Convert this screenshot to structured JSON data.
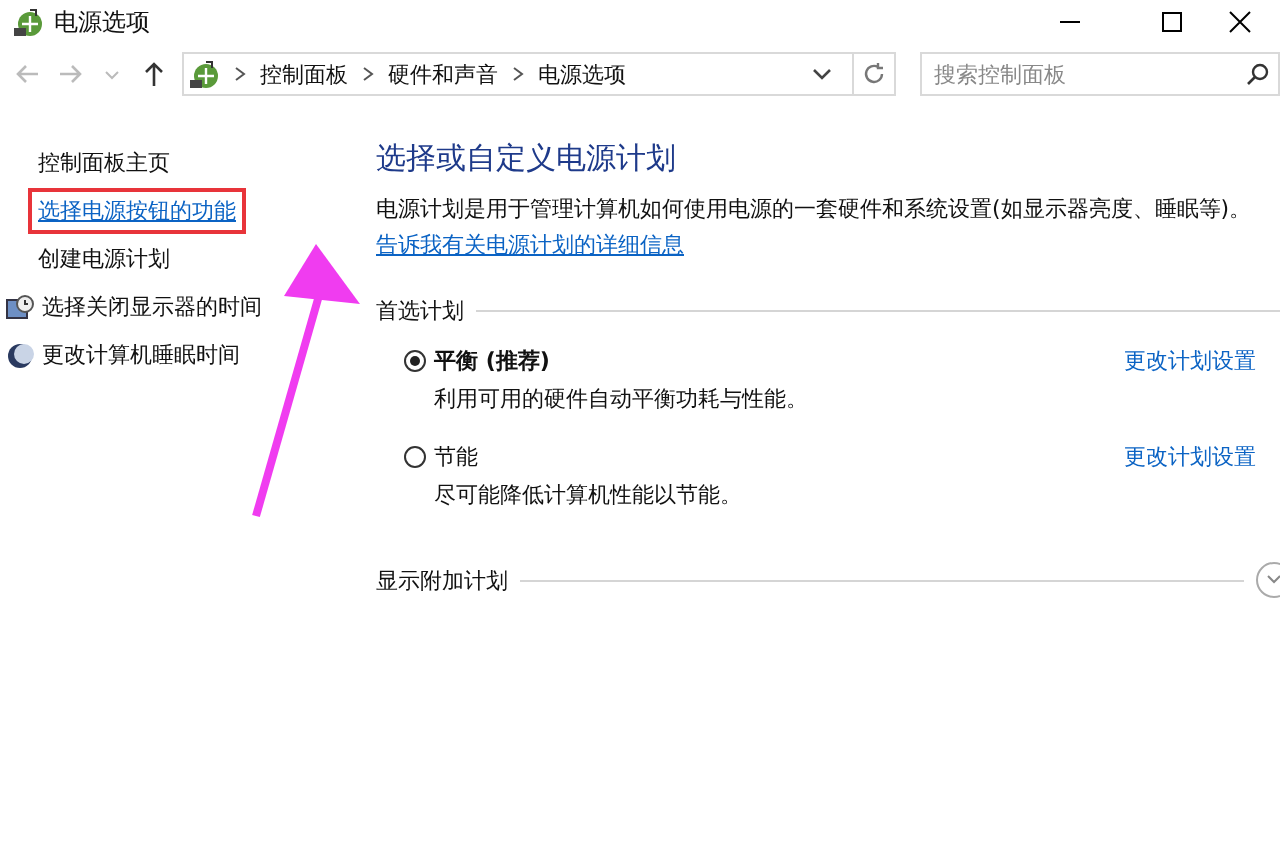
{
  "window": {
    "title": "电源选项"
  },
  "address_bar": {
    "crumbs": [
      "控制面板",
      "硬件和声音",
      "电源选项"
    ],
    "search_placeholder": "搜索控制面板"
  },
  "sidebar": {
    "items": [
      {
        "label": "控制面板主页",
        "kind": "plain"
      },
      {
        "label": "选择电源按钮的功能",
        "kind": "link",
        "highlighted": true
      },
      {
        "label": "创建电源计划",
        "kind": "plain"
      },
      {
        "label": "选择关闭显示器的时间",
        "kind": "monitor"
      },
      {
        "label": "更改计算机睡眠时间",
        "kind": "moon"
      }
    ]
  },
  "main": {
    "heading": "选择或自定义电源计划",
    "description": "电源计划是用于管理计算机如何使用电源的一套硬件和系统设置(如显示器亮度、睡眠等)。",
    "help_link": "告诉我有关电源计划的详细信息",
    "group_title": "首选计划",
    "plans": [
      {
        "name": "平衡 (推荐)",
        "selected": true,
        "description": "利用可用的硬件自动平衡功耗与性能。",
        "settings_link": "更改计划设置"
      },
      {
        "name": "节能",
        "selected": false,
        "description": "尽可能降低计算机性能以节能。",
        "settings_link": "更改计划设置"
      }
    ],
    "more_plans": "显示附加计划"
  }
}
